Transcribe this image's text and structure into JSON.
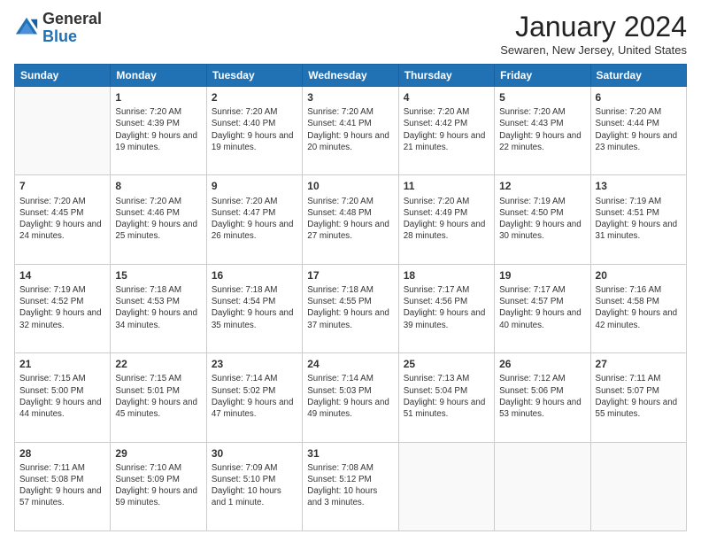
{
  "header": {
    "logo": {
      "line1": "General",
      "line2": "Blue"
    },
    "title": "January 2024",
    "location": "Sewaren, New Jersey, United States"
  },
  "weekdays": [
    "Sunday",
    "Monday",
    "Tuesday",
    "Wednesday",
    "Thursday",
    "Friday",
    "Saturday"
  ],
  "weeks": [
    [
      {
        "day": null
      },
      {
        "day": 1,
        "sunrise": "7:20 AM",
        "sunset": "4:39 PM",
        "daylight": "9 hours and 19 minutes."
      },
      {
        "day": 2,
        "sunrise": "7:20 AM",
        "sunset": "4:40 PM",
        "daylight": "9 hours and 19 minutes."
      },
      {
        "day": 3,
        "sunrise": "7:20 AM",
        "sunset": "4:41 PM",
        "daylight": "9 hours and 20 minutes."
      },
      {
        "day": 4,
        "sunrise": "7:20 AM",
        "sunset": "4:42 PM",
        "daylight": "9 hours and 21 minutes."
      },
      {
        "day": 5,
        "sunrise": "7:20 AM",
        "sunset": "4:43 PM",
        "daylight": "9 hours and 22 minutes."
      },
      {
        "day": 6,
        "sunrise": "7:20 AM",
        "sunset": "4:44 PM",
        "daylight": "9 hours and 23 minutes."
      }
    ],
    [
      {
        "day": 7,
        "sunrise": "7:20 AM",
        "sunset": "4:45 PM",
        "daylight": "9 hours and 24 minutes."
      },
      {
        "day": 8,
        "sunrise": "7:20 AM",
        "sunset": "4:46 PM",
        "daylight": "9 hours and 25 minutes."
      },
      {
        "day": 9,
        "sunrise": "7:20 AM",
        "sunset": "4:47 PM",
        "daylight": "9 hours and 26 minutes."
      },
      {
        "day": 10,
        "sunrise": "7:20 AM",
        "sunset": "4:48 PM",
        "daylight": "9 hours and 27 minutes."
      },
      {
        "day": 11,
        "sunrise": "7:20 AM",
        "sunset": "4:49 PM",
        "daylight": "9 hours and 28 minutes."
      },
      {
        "day": 12,
        "sunrise": "7:19 AM",
        "sunset": "4:50 PM",
        "daylight": "9 hours and 30 minutes."
      },
      {
        "day": 13,
        "sunrise": "7:19 AM",
        "sunset": "4:51 PM",
        "daylight": "9 hours and 31 minutes."
      }
    ],
    [
      {
        "day": 14,
        "sunrise": "7:19 AM",
        "sunset": "4:52 PM",
        "daylight": "9 hours and 32 minutes."
      },
      {
        "day": 15,
        "sunrise": "7:18 AM",
        "sunset": "4:53 PM",
        "daylight": "9 hours and 34 minutes."
      },
      {
        "day": 16,
        "sunrise": "7:18 AM",
        "sunset": "4:54 PM",
        "daylight": "9 hours and 35 minutes."
      },
      {
        "day": 17,
        "sunrise": "7:18 AM",
        "sunset": "4:55 PM",
        "daylight": "9 hours and 37 minutes."
      },
      {
        "day": 18,
        "sunrise": "7:17 AM",
        "sunset": "4:56 PM",
        "daylight": "9 hours and 39 minutes."
      },
      {
        "day": 19,
        "sunrise": "7:17 AM",
        "sunset": "4:57 PM",
        "daylight": "9 hours and 40 minutes."
      },
      {
        "day": 20,
        "sunrise": "7:16 AM",
        "sunset": "4:58 PM",
        "daylight": "9 hours and 42 minutes."
      }
    ],
    [
      {
        "day": 21,
        "sunrise": "7:15 AM",
        "sunset": "5:00 PM",
        "daylight": "9 hours and 44 minutes."
      },
      {
        "day": 22,
        "sunrise": "7:15 AM",
        "sunset": "5:01 PM",
        "daylight": "9 hours and 45 minutes."
      },
      {
        "day": 23,
        "sunrise": "7:14 AM",
        "sunset": "5:02 PM",
        "daylight": "9 hours and 47 minutes."
      },
      {
        "day": 24,
        "sunrise": "7:14 AM",
        "sunset": "5:03 PM",
        "daylight": "9 hours and 49 minutes."
      },
      {
        "day": 25,
        "sunrise": "7:13 AM",
        "sunset": "5:04 PM",
        "daylight": "9 hours and 51 minutes."
      },
      {
        "day": 26,
        "sunrise": "7:12 AM",
        "sunset": "5:06 PM",
        "daylight": "9 hours and 53 minutes."
      },
      {
        "day": 27,
        "sunrise": "7:11 AM",
        "sunset": "5:07 PM",
        "daylight": "9 hours and 55 minutes."
      }
    ],
    [
      {
        "day": 28,
        "sunrise": "7:11 AM",
        "sunset": "5:08 PM",
        "daylight": "9 hours and 57 minutes."
      },
      {
        "day": 29,
        "sunrise": "7:10 AM",
        "sunset": "5:09 PM",
        "daylight": "9 hours and 59 minutes."
      },
      {
        "day": 30,
        "sunrise": "7:09 AM",
        "sunset": "5:10 PM",
        "daylight": "10 hours and 1 minute."
      },
      {
        "day": 31,
        "sunrise": "7:08 AM",
        "sunset": "5:12 PM",
        "daylight": "10 hours and 3 minutes."
      },
      {
        "day": null
      },
      {
        "day": null
      },
      {
        "day": null
      }
    ]
  ],
  "labels": {
    "sunrise_prefix": "Sunrise: ",
    "sunset_prefix": "Sunset: ",
    "daylight_prefix": "Daylight: "
  }
}
